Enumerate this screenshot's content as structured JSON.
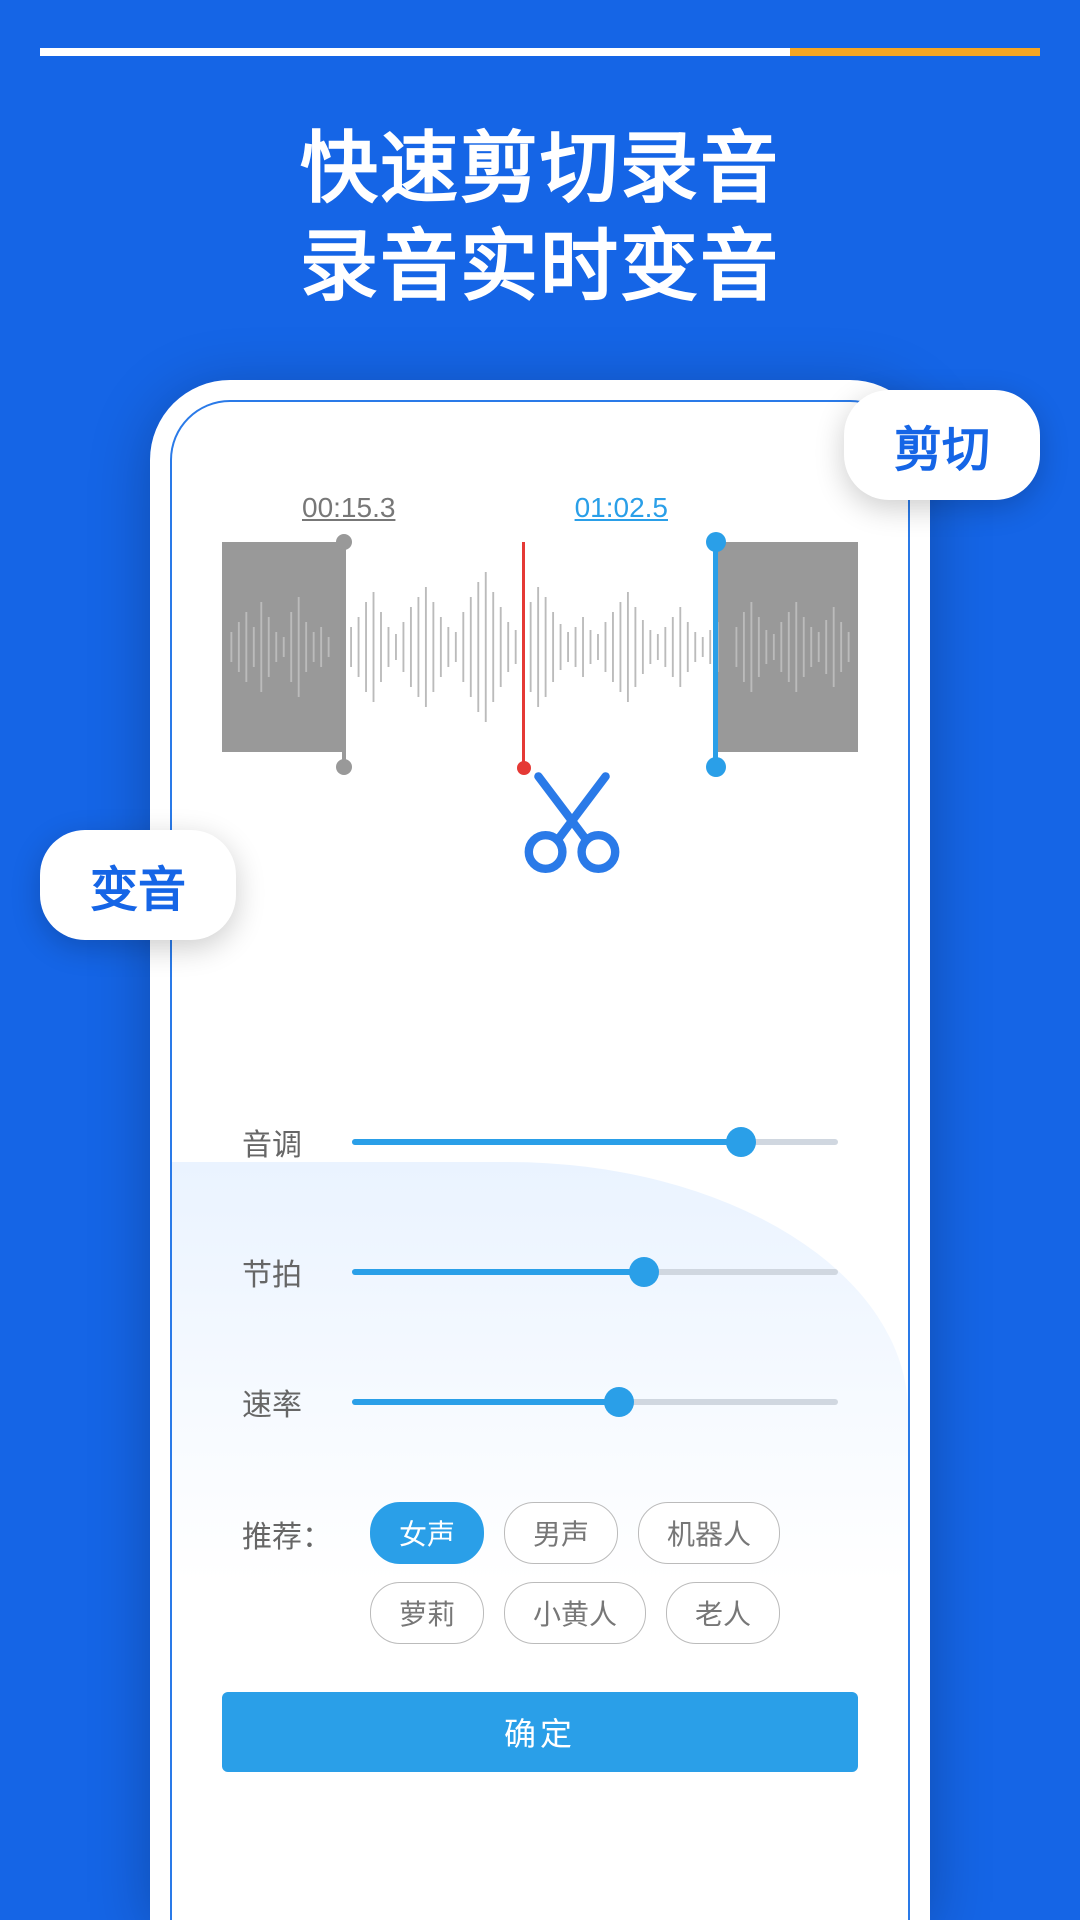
{
  "headline": {
    "line1": "快速剪切录音",
    "line2": "录音实时变音"
  },
  "badges": {
    "cut": "剪切",
    "voice": "变音"
  },
  "cut": {
    "start_time": "00:15.3",
    "end_time": "01:02.5"
  },
  "sliders": {
    "pitch": {
      "label": "音调",
      "value": 80
    },
    "tempo": {
      "label": "节拍",
      "value": 60
    },
    "speed": {
      "label": "速率",
      "value": 55
    }
  },
  "presets": {
    "label": "推荐：",
    "options": [
      "女声",
      "男声",
      "机器人",
      "萝莉",
      "小黄人",
      "老人"
    ],
    "active": "女声"
  },
  "confirm": "确定"
}
